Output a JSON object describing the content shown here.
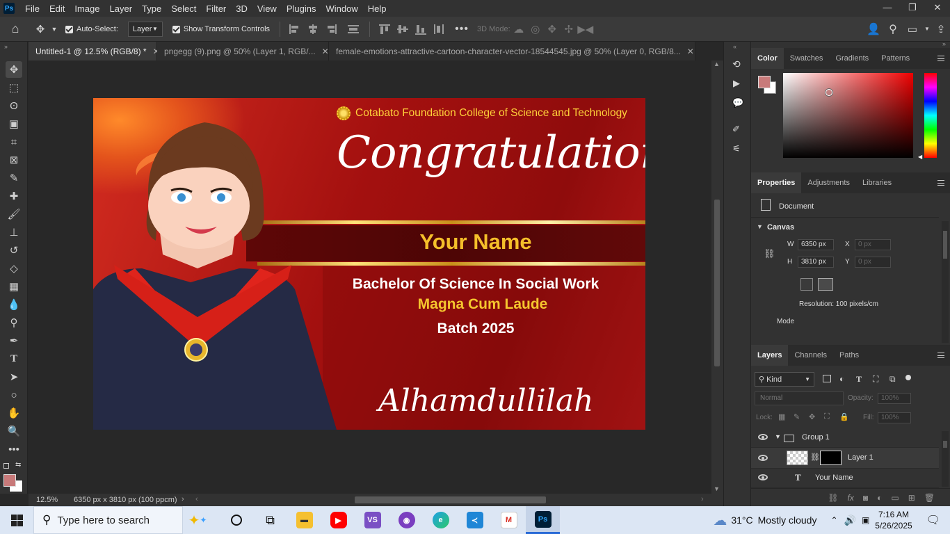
{
  "app": {
    "logo": "Ps"
  },
  "menu": [
    "File",
    "Edit",
    "Image",
    "Layer",
    "Type",
    "Select",
    "Filter",
    "3D",
    "View",
    "Plugins",
    "Window",
    "Help"
  ],
  "options": {
    "auto_select_label": "Auto-Select:",
    "auto_select_value": "Layer",
    "transform_label": "Show Transform Controls",
    "mode3d_label": "3D Mode:"
  },
  "tabs": [
    {
      "label": "Untitled-1 @ 12.5% (RGB/8) *"
    },
    {
      "label": "pngegg (9).png @ 50% (Layer 1, RGB/..."
    },
    {
      "label": "female-emotions-attractive-cartoon-character-vector-18544545.jpg @ 50% (Layer 0, RGB/8..."
    }
  ],
  "document": {
    "college": "Cotabato Foundation College of Science and Technology",
    "headline": "Congratulation!",
    "name": "Your Name",
    "degree": "Bachelor Of Science In Social Work",
    "honor": "Magna Cum Laude",
    "batch": "Batch 2025",
    "closing": "Alhamdullilah"
  },
  "status": {
    "zoom": "12.5%",
    "doc_info": "6350 px x 3810 px (100 ppcm)"
  },
  "color_panel": {
    "tabs": [
      "Color",
      "Swatches",
      "Gradients",
      "Patterns"
    ],
    "foreground": "#c87a7a"
  },
  "properties_panel": {
    "tabs": [
      "Properties",
      "Adjustments",
      "Libraries"
    ],
    "doc_label": "Document",
    "section": "Canvas",
    "w_label": "W",
    "w_value": "6350 px",
    "h_label": "H",
    "h_value": "3810 px",
    "x_label": "X",
    "x_value": "0 px",
    "y_label": "Y",
    "y_value": "0 px",
    "resolution": "Resolution: 100 pixels/cm",
    "mode_label": "Mode"
  },
  "layers_panel": {
    "tabs": [
      "Layers",
      "Channels",
      "Paths"
    ],
    "filter_kind": "Kind",
    "blend_mode": "Normal",
    "opacity_label": "Opacity:",
    "opacity_value": "100%",
    "lock_label": "Lock:",
    "fill_label": "Fill:",
    "fill_value": "100%",
    "layers": [
      {
        "name": "Group 1",
        "type": "group"
      },
      {
        "name": "Layer 1",
        "type": "pixel"
      },
      {
        "name": "Your Name",
        "type": "text"
      }
    ]
  },
  "taskbar": {
    "search_placeholder": "Type here to search",
    "weather_temp": "31°C",
    "weather_desc": "Mostly cloudy",
    "time": "7:16 AM",
    "date": "5/26/2025"
  }
}
